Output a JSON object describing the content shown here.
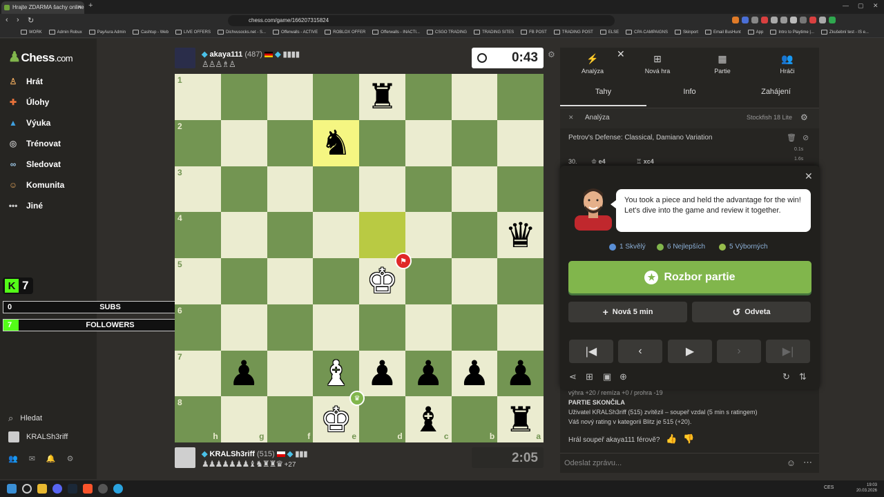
{
  "browser": {
    "tab_title": "Hrajte ZDARMA šachy online – ...",
    "url": "chess.com/game/166207315824",
    "bookmarks": [
      "WORK",
      "Admin Robux",
      "PayAura Admin",
      "Cashtup - Web",
      "LIVE OFFERS",
      "Dichvusocks.net - S...",
      "Offerwalls - ACTIVE",
      "ROBLOX OFFER",
      "Offerwalls - INACTI...",
      "CSGO TRADING",
      "TRADING SITES",
      "FB POST",
      "TRADING POST",
      "ELSE",
      "CPA CAMPAIGNS",
      "Skinport",
      "Email BusHunt",
      "App",
      "Intro to Playtime |...",
      "Zkušební test - IS e..."
    ]
  },
  "sidebar": {
    "logo_main": "Chess",
    "logo_dom": ".com",
    "items": [
      {
        "label": "Hrát",
        "icon": "pawn-hand-icon"
      },
      {
        "label": "Úlohy",
        "icon": "puzzle-icon"
      },
      {
        "label": "Výuka",
        "icon": "graduation-cap-icon"
      },
      {
        "label": "Trénovat",
        "icon": "target-icon"
      },
      {
        "label": "Sledovat",
        "icon": "binoculars-icon"
      },
      {
        "label": "Komunita",
        "icon": "community-icon"
      },
      {
        "label": "Jiné",
        "icon": "ellipsis-icon"
      }
    ],
    "search_label": "Hledat",
    "user_label": "KRALSh3riff"
  },
  "overlay": {
    "kick_count": "7",
    "subs": {
      "current": "0",
      "label": "SUBS",
      "goal": "10",
      "progress": 0.0
    },
    "followers": {
      "current": "7",
      "label": "FOLLOWERS",
      "goal": "100",
      "progress": 0.07
    }
  },
  "top_player": {
    "name": "akaya111",
    "rating": "(487)",
    "clock": "0:43"
  },
  "bottom_player": {
    "name": "KRALSh3riff",
    "rating": "(515)",
    "captured_extra": "+27",
    "clock": "2:05"
  },
  "board": {
    "ranks": [
      "1",
      "2",
      "3",
      "4",
      "5",
      "6",
      "7",
      "8"
    ],
    "files": [
      "h",
      "g",
      "f",
      "e",
      "d",
      "c",
      "b",
      "a"
    ],
    "pieces": [
      {
        "row": 0,
        "col": 4,
        "glyph": "♜",
        "color": "b"
      },
      {
        "row": 1,
        "col": 3,
        "glyph": "♞",
        "color": "b"
      },
      {
        "row": 3,
        "col": 7,
        "glyph": "♛",
        "color": "b"
      },
      {
        "row": 4,
        "col": 4,
        "glyph": "♚",
        "color": "w"
      },
      {
        "row": 6,
        "col": 1,
        "glyph": "♟",
        "color": "b"
      },
      {
        "row": 6,
        "col": 3,
        "glyph": "♝",
        "color": "w"
      },
      {
        "row": 6,
        "col": 4,
        "glyph": "♟",
        "color": "b"
      },
      {
        "row": 6,
        "col": 5,
        "glyph": "♟",
        "color": "b"
      },
      {
        "row": 6,
        "col": 6,
        "glyph": "♟",
        "color": "b"
      },
      {
        "row": 6,
        "col": 7,
        "glyph": "♟",
        "color": "b"
      },
      {
        "row": 7,
        "col": 3,
        "glyph": "♚",
        "color": "w"
      },
      {
        "row": 7,
        "col": 5,
        "glyph": "♝",
        "color": "b"
      },
      {
        "row": 7,
        "col": 7,
        "glyph": "♜",
        "color": "b"
      }
    ],
    "highlights": [
      {
        "row": 1,
        "col": 3
      },
      {
        "row": 3,
        "col": 4
      }
    ]
  },
  "panel": {
    "tabs": [
      {
        "label": "Analýza",
        "icon": "bolt-icon"
      },
      {
        "label": "Nová hra",
        "icon": "plus-square-icon"
      },
      {
        "label": "Partie",
        "icon": "board-icon"
      },
      {
        "label": "Hráči",
        "icon": "players-icon"
      }
    ],
    "subtabs": [
      "Tahy",
      "Info",
      "Zahájení"
    ],
    "analysis_label": "Analýza",
    "engine_label": "Stockfish 18 Lite",
    "opening": "Petrov's Defense: Classical, Damiano Variation",
    "move_row": {
      "num": "30.",
      "white": "e4",
      "black": "xc4",
      "t1": "0.1s",
      "t2": "1.6s"
    }
  },
  "coach": {
    "message": "You took a piece and held the advantage for the win! Let's dive into the game and review it together.",
    "stats": [
      {
        "label": "1 Skvělý",
        "color": "#5a8fd6"
      },
      {
        "label": "6 Nejlepších",
        "color": "#81b64c"
      },
      {
        "label": "5 Výborných",
        "color": "#96bc4b"
      }
    ],
    "review_label": "Rozbor partie",
    "new_game_label": "Nová 5 min",
    "rematch_label": "Odveta"
  },
  "game_over": {
    "scoreline": "výhra +20 / remíza +0 / prohra -19",
    "heading": "PARTIE SKONČILA",
    "line1": "Uživatel KRALSh3riff (515) zvítězil – soupeř vzdal (5 min s ratingem)",
    "line2": "Váš nový rating v kategorii Blitz je 515 (+20).",
    "fair_question": "Hrál soupeř akaya111 férově?"
  },
  "chat": {
    "placeholder": "Odeslat zprávu..."
  },
  "taskbar": {
    "lang": "CES",
    "time": "19:03",
    "date": "20.03.2026"
  }
}
